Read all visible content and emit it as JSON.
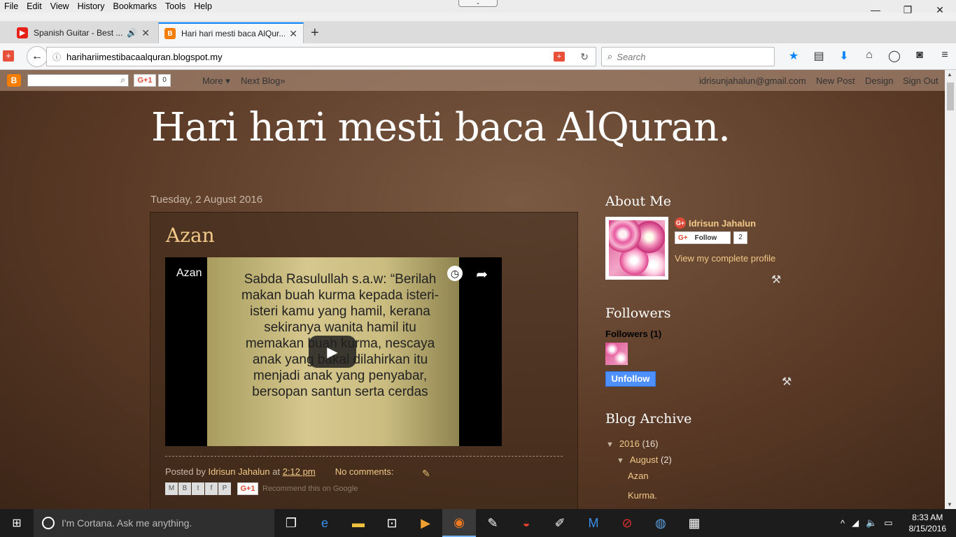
{
  "menu": [
    "File",
    "Edit",
    "View",
    "History",
    "Bookmarks",
    "Tools",
    "Help"
  ],
  "window_controls": {
    "minimize": "—",
    "restore": "❐",
    "close": "✕"
  },
  "tabs": [
    {
      "title": "Spanish Guitar - Best ...",
      "favicon": "youtube-icon",
      "color": "#e62117"
    },
    {
      "title": "Hari hari mesti baca AlQur...",
      "favicon": "blogger-icon",
      "color": "#f57d00"
    }
  ],
  "nav": {
    "url": "harihariimestibacaalquran.blogspot.my",
    "search_placeholder": "Search"
  },
  "blogger_bar": {
    "gplus_label": "G+1",
    "gplus_count": "0",
    "more": "More ▾",
    "next_blog": "Next Blog»",
    "email": "idrisunjahalun@gmail.com",
    "new_post": "New Post",
    "design": "Design",
    "sign_out": "Sign Out"
  },
  "blog": {
    "title": "Hari hari mesti baca AlQuran.",
    "date": "Tuesday, 2 August 2016",
    "post": {
      "title": "Azan",
      "video_title": "Azan",
      "video_text": "Sabda Rasulullah s.a.w: “Berilah makan buah kurma kepada isteri-isteri kamu yang hamil, kerana sekiranya wanita hamil itu memakan buah kurma, nescaya anak yang bakal dilahirkan itu menjadi anak yang penyabar, bersopan santun serta cerdas",
      "posted_by": "Posted by",
      "author": "Idrisun Jahalun",
      "at": "at",
      "time": "2:12 pm",
      "comments": "No comments:",
      "share_buttons": [
        "M",
        "B",
        "t",
        "f",
        "P"
      ],
      "gplus": "G+1",
      "recommend": "Recommend this on Google"
    }
  },
  "sidebar": {
    "about_title": "About Me",
    "profile_name": "Idrisun Jahalun",
    "follow_label": "Follow",
    "follow_count": "2",
    "view_profile": "View my complete profile",
    "followers_title": "Followers",
    "followers_label": "Followers (1)",
    "unfollow": "Unfollow",
    "archive_title": "Blog Archive",
    "archive": [
      {
        "label": "2016",
        "count": "(16)"
      },
      {
        "label": "August",
        "count": "(2)"
      },
      {
        "label": "Azan"
      },
      {
        "label": "Kurma."
      }
    ]
  },
  "taskbar": {
    "cortana": "I'm Cortana. Ask me anything.",
    "time": "8:33 AM",
    "date": "8/15/2016"
  }
}
